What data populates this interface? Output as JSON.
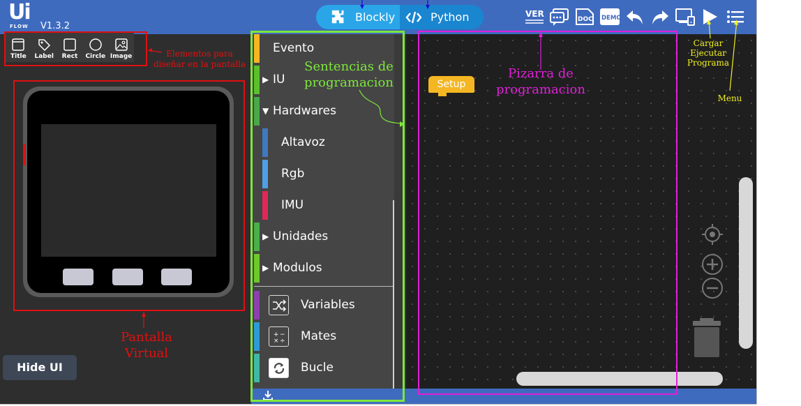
{
  "topbar": {
    "logo_text": "Ui",
    "logo_sub": "FLOW",
    "version": "V1.3.2",
    "mode_blockly": "Blockly",
    "mode_python": "Python",
    "icons": [
      "ver-icon",
      "comments-icon",
      "doc-icon",
      "demo-icon",
      "undo-icon",
      "redo-icon",
      "device-connect-icon",
      "play-icon",
      "menu-icon"
    ],
    "ver_label": "VER.",
    "doc_label": "DOC",
    "demo_label": "DEMO"
  },
  "ui_tools": [
    {
      "label": "Title",
      "icon": "title-icon"
    },
    {
      "label": "Label",
      "icon": "tag-icon"
    },
    {
      "label": "Rect",
      "icon": "rect-icon"
    },
    {
      "label": "Circle",
      "icon": "circle-icon"
    },
    {
      "label": "Image",
      "icon": "image-icon"
    }
  ],
  "hide_ui": "Hide UI",
  "categories": {
    "evento": "Evento",
    "iu": "IU",
    "hardwares": "Hardwares",
    "altavoz": "Altavoz",
    "rgb": "Rgb",
    "imu": "IMU",
    "unidades": "Unidades",
    "modulos": "Modulos",
    "variables": "Variables",
    "mates": "Mates",
    "bucle": "Bucle"
  },
  "workspace": {
    "setup_block": "Setup"
  },
  "annotations": {
    "elementos": "Elementos para\ndiseñar en la pantalla",
    "pantalla": "Pantalla\nVirtual",
    "sentencias": "Sentencias de\nprogramacion",
    "pizarra": "Pizarra de\nprogramacion",
    "cargar": "Cargar\nEjecutar\nPrograma",
    "menu": "Menu"
  },
  "colors": {
    "topbar": "#3f6bbf",
    "annotation_red": "#e01010",
    "annotation_green": "#7de83a",
    "annotation_magenta": "#e020d8",
    "annotation_yellow": "#f0f020",
    "annotation_blue": "#1010d0"
  }
}
